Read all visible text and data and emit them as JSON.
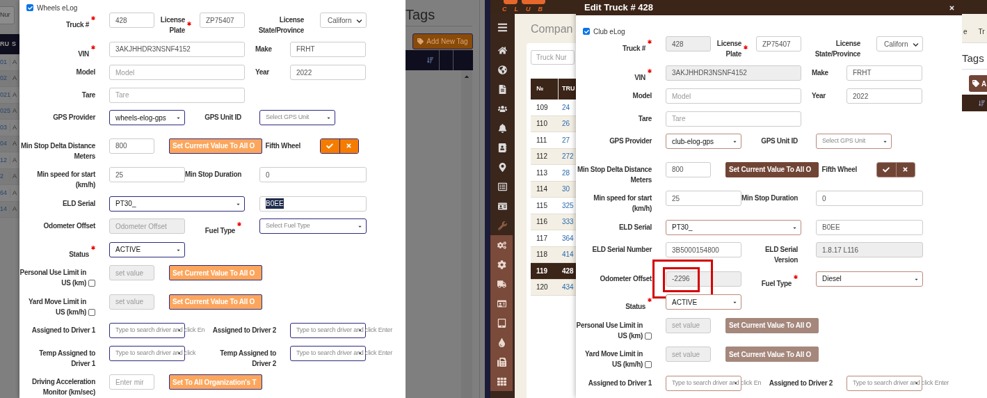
{
  "left_screen": {
    "background_table": {
      "search_placeholder": "Nur",
      "columns": [
        "RU",
        "S"
      ],
      "rows": [
        [
          "01",
          "A"
        ],
        [
          "02",
          "A"
        ],
        [
          "021",
          "A"
        ],
        [
          "025",
          "A"
        ],
        [
          "03",
          "A"
        ],
        [
          "04",
          "A"
        ],
        [
          "12",
          "A"
        ],
        [
          "2",
          "A"
        ],
        [
          "64",
          "A"
        ],
        [
          "14",
          "A"
        ]
      ]
    },
    "tags_panel": {
      "title": "Tags",
      "button": "Add New Tag"
    },
    "form": {
      "checkbox": {
        "label": "Wheels eLog",
        "checked": true
      },
      "groups": [
        {
          "kind": "triple",
          "cells": [
            {
              "kind": "label",
              "text": "Truck #",
              "required": true
            },
            {
              "kind": "input",
              "value": "428",
              "disabled": false
            },
            {
              "kind": "label",
              "text": "License Plate",
              "required": true
            },
            {
              "kind": "input",
              "value": "ZP75407",
              "disabled": false
            },
            {
              "kind": "label",
              "text": "License State/Province",
              "required": false
            },
            {
              "kind": "native-select",
              "value": "Californ"
            }
          ]
        },
        {
          "kind": "wide-pair",
          "cells": [
            {
              "kind": "label",
              "text": "VIN",
              "required": true
            },
            {
              "kind": "input",
              "value": "3AKJHHDR3NSNF4152",
              "disabled": false
            },
            {
              "kind": "label",
              "text": "Make",
              "required": false
            },
            {
              "kind": "input",
              "value": "FRHT",
              "disabled": false
            }
          ]
        },
        {
          "kind": "wide-pair",
          "cells": [
            {
              "kind": "label",
              "text": "Model",
              "required": false
            },
            {
              "kind": "input",
              "placeholder": "Model",
              "disabled": false
            },
            {
              "kind": "label",
              "text": "Year",
              "required": false
            },
            {
              "kind": "input",
              "value": "2022",
              "disabled": false
            }
          ]
        },
        {
          "kind": "wide-single",
          "cells": [
            {
              "kind": "label",
              "text": "Tare",
              "required": false
            },
            {
              "kind": "input",
              "placeholder": "Tare",
              "disabled": false
            }
          ]
        },
        {
          "kind": "mid-pair-short",
          "cells": [
            {
              "kind": "label",
              "text": "GPS Provider",
              "required": false
            },
            {
              "kind": "select",
              "value": "wheels-elog-gps"
            },
            {
              "kind": "label",
              "text": "GPS Unit ID",
              "required": false
            },
            {
              "kind": "select",
              "placeholder": "Select GPS Unit"
            }
          ]
        },
        {
          "kind": "action-toggle",
          "cells": [
            {
              "kind": "label",
              "text": "Min Stop Delta Distance Meters",
              "required": false
            },
            {
              "kind": "input",
              "value": "800",
              "disabled": false
            },
            {
              "kind": "button",
              "text": "Set Current Value To All O",
              "disabled": true
            },
            {
              "kind": "label",
              "text": "Fifth Wheel",
              "required": false
            },
            {
              "kind": "toggle"
            }
          ]
        },
        {
          "kind": "mid-pair",
          "cells": [
            {
              "kind": "label",
              "text": "Min speed for start (km/h)",
              "required": false
            },
            {
              "kind": "input",
              "value": "25",
              "disabled": false
            },
            {
              "kind": "label",
              "text": "Min Stop Duration",
              "required": false
            },
            {
              "kind": "input",
              "value": "0",
              "disabled": false
            }
          ]
        },
        {
          "kind": "wide-plain",
          "cells": [
            {
              "kind": "label",
              "text": "ELD Serial",
              "required": false
            },
            {
              "kind": "select",
              "value": "PT30_"
            },
            {
              "kind": "input",
              "value": "B0EE",
              "disabled": false,
              "text_selected": true
            }
          ]
        },
        {
          "kind": "mid-pair",
          "cells": [
            {
              "kind": "label",
              "text": "Odometer Offset",
              "required": false
            },
            {
              "kind": "input",
              "placeholder": "Odometer Offset",
              "disabled": true
            },
            {
              "kind": "label",
              "text": "Fuel Type",
              "required": true
            },
            {
              "kind": "select",
              "placeholder": "Select Fuel Type"
            }
          ]
        },
        {
          "kind": "mid-single",
          "cells": [
            {
              "kind": "label",
              "text": "Status",
              "required": true
            },
            {
              "kind": "select",
              "value": "ACTIVE"
            }
          ]
        },
        {
          "kind": "action",
          "cells": [
            {
              "kind": "label",
              "text": "Personal Use Limit in US (km)",
              "required": false,
              "checkbox": {
                "checked": false
              }
            },
            {
              "kind": "input",
              "placeholder": "set value",
              "disabled": true
            },
            {
              "kind": "button",
              "text": "Set Current Value To All O",
              "disabled": true
            }
          ]
        },
        {
          "kind": "action",
          "cells": [
            {
              "kind": "label",
              "text": "Yard Move Limit in US (km/h)",
              "required": false,
              "checkbox": {
                "checked": false
              }
            },
            {
              "kind": "input",
              "placeholder": "set value",
              "disabled": true
            },
            {
              "kind": "button",
              "text": "Set Current Value To All O",
              "disabled": true
            }
          ]
        },
        {
          "kind": "driver-pair",
          "cells": [
            {
              "kind": "label",
              "text": "Assigned to Driver 1",
              "required": false
            },
            {
              "kind": "select",
              "placeholder": "Type to search driver and click En"
            },
            {
              "kind": "label",
              "text": "Assigned to Driver 2",
              "required": false
            },
            {
              "kind": "select",
              "placeholder": "Type to search driver and click Enter"
            }
          ]
        },
        {
          "kind": "driver-pair",
          "cells": [
            {
              "kind": "label",
              "text": "Temp Assigned to Driver 1",
              "required": false
            },
            {
              "kind": "select",
              "placeholder": "Type to search driver and click"
            },
            {
              "kind": "label",
              "text": "Temp Assigned to Driver 2",
              "required": false
            },
            {
              "kind": "select",
              "placeholder": "Type to search driver and click Enter"
            }
          ]
        },
        {
          "kind": "action",
          "cells": [
            {
              "kind": "label",
              "text": "Driving Acceleration Monitor (km/sec)",
              "required": false
            },
            {
              "kind": "input",
              "placeholder": "Enter mir",
              "disabled": false
            },
            {
              "kind": "button",
              "text": "Set To All Organization's T",
              "disabled": true
            }
          ]
        }
      ]
    }
  },
  "right_screen": {
    "logo": "CLUB",
    "sidebar": {
      "items": [
        {
          "expanded": false
        },
        {
          "expanded": false
        },
        {
          "expanded": false
        },
        {
          "expanded": false
        },
        {
          "expanded": false
        },
        {
          "expanded": false
        },
        {
          "expanded": false
        },
        {
          "expanded": false
        },
        {
          "expanded": false
        },
        {
          "expanded": true,
          "children": [
            {
              "selected": false
            },
            {
              "selected": false
            },
            {
              "selected": false
            },
            {
              "selected": false
            },
            {
              "selected": false
            },
            {
              "selected": false
            },
            {
              "selected": false
            },
            {
              "selected": false
            }
          ]
        }
      ]
    },
    "page": {
      "title": "Compan",
      "search_placeholder": "Truck Nur",
      "table": {
        "columns": [
          "№",
          "TRU"
        ],
        "rows": [
          {
            "cells": [
              "109",
              "24"
            ],
            "selected": false
          },
          {
            "cells": [
              "110",
              "26"
            ],
            "selected": false
          },
          {
            "cells": [
              "111",
              "27"
            ],
            "selected": false
          },
          {
            "cells": [
              "112",
              "272"
            ],
            "selected": false
          },
          {
            "cells": [
              "113",
              "28"
            ],
            "selected": false
          },
          {
            "cells": [
              "114",
              "30"
            ],
            "selected": false
          },
          {
            "cells": [
              "115",
              "325"
            ],
            "selected": false
          },
          {
            "cells": [
              "116",
              "333"
            ],
            "selected": false
          },
          {
            "cells": [
              "117",
              "364"
            ],
            "selected": false
          },
          {
            "cells": [
              "118",
              "414"
            ],
            "selected": false
          },
          {
            "cells": [
              "119",
              "428"
            ],
            "selected": true
          },
          {
            "cells": [
              "120",
              "434"
            ],
            "selected": false
          }
        ]
      }
    },
    "tabs": [
      {
        "label": "e",
        "selected": false
      },
      {
        "label": "Tr",
        "selected": false
      }
    ],
    "tags_panel": {
      "title": "Tags",
      "button": "A"
    },
    "modal": {
      "title": "Edit Truck # 428",
      "form": {
        "checkbox": {
          "label": "Club eLog",
          "checked": true
        },
        "groups": [
          {
            "kind": "triple",
            "cells": [
              {
                "kind": "label",
                "text": "Truck #",
                "required": true
              },
              {
                "kind": "input",
                "value": "428",
                "disabled": true
              },
              {
                "kind": "label",
                "text": "License Plate",
                "required": true
              },
              {
                "kind": "input",
                "value": "ZP75407",
                "disabled": false
              },
              {
                "kind": "label",
                "text": "License State/Province",
                "required": false
              },
              {
                "kind": "native-select",
                "value": "Californ"
              }
            ]
          },
          {
            "kind": "wide-pair",
            "cells": [
              {
                "kind": "label",
                "text": "VIN",
                "required": true
              },
              {
                "kind": "input",
                "value": "3AKJHHDR3NSNF4152",
                "disabled": true
              },
              {
                "kind": "label",
                "text": "Make",
                "required": false
              },
              {
                "kind": "input",
                "value": "FRHT",
                "disabled": false
              }
            ]
          },
          {
            "kind": "wide-pair",
            "cells": [
              {
                "kind": "label",
                "text": "Model",
                "required": false
              },
              {
                "kind": "input",
                "placeholder": "Model",
                "disabled": false
              },
              {
                "kind": "label",
                "text": "Year",
                "required": false
              },
              {
                "kind": "input",
                "value": "2022",
                "disabled": false
              }
            ]
          },
          {
            "kind": "wide-single",
            "cells": [
              {
                "kind": "label",
                "text": "Tare",
                "required": false
              },
              {
                "kind": "input",
                "placeholder": "Tare",
                "disabled": false
              }
            ]
          },
          {
            "kind": "mid-pair-short",
            "cells": [
              {
                "kind": "label",
                "text": "GPS Provider",
                "required": false
              },
              {
                "kind": "select",
                "value": "club-elog-gps"
              },
              {
                "kind": "label",
                "text": "GPS Unit ID",
                "required": false
              },
              {
                "kind": "select",
                "placeholder": "Select GPS Unit"
              }
            ]
          },
          {
            "kind": "action-toggle",
            "cells": [
              {
                "kind": "label",
                "text": "Min Stop Delta Distance Meters",
                "required": false
              },
              {
                "kind": "input",
                "value": "800",
                "disabled": false
              },
              {
                "kind": "button",
                "text": "Set Current Value To All O",
                "disabled": false
              },
              {
                "kind": "label",
                "text": "Fifth Wheel",
                "required": false
              },
              {
                "kind": "toggle"
              }
            ]
          },
          {
            "kind": "mid-pair",
            "cells": [
              {
                "kind": "label",
                "text": "Min speed for start (km/h)",
                "required": false
              },
              {
                "kind": "input",
                "value": "25",
                "disabled": false
              },
              {
                "kind": "label",
                "text": "Min Stop Duration",
                "required": false
              },
              {
                "kind": "input",
                "value": "0",
                "disabled": false
              }
            ]
          },
          {
            "kind": "wide-plain",
            "cells": [
              {
                "kind": "label",
                "text": "ELD Serial",
                "required": false
              },
              {
                "kind": "select",
                "value": "PT30_"
              },
              {
                "kind": "input",
                "value": "B0EE",
                "disabled": false,
                "text_selected": false
              }
            ]
          },
          {
            "kind": "mid-pair",
            "cells": [
              {
                "kind": "label",
                "text": "ELD Serial Number",
                "required": false
              },
              {
                "kind": "input",
                "value": "3B5000154800",
                "disabled": false
              },
              {
                "kind": "label",
                "text": "ELD Serial Version",
                "required": false
              },
              {
                "kind": "input",
                "value": "1.8.17 L116",
                "disabled": true
              }
            ]
          },
          {
            "kind": "mid-pair",
            "cells": [
              {
                "kind": "label",
                "text": "Odometer Offset",
                "required": false
              },
              {
                "kind": "input",
                "value": "-2296",
                "disabled": true,
                "annotated": true
              },
              {
                "kind": "label",
                "text": "Fuel Type",
                "required": true
              },
              {
                "kind": "select",
                "value": "Diesel"
              }
            ]
          },
          {
            "kind": "mid-single",
            "cells": [
              {
                "kind": "label",
                "text": "Status",
                "required": true
              },
              {
                "kind": "select",
                "value": "ACTIVE"
              }
            ]
          },
          {
            "kind": "action",
            "cells": [
              {
                "kind": "label",
                "text": "Personal Use Limit in US (km)",
                "required": false,
                "checkbox": {
                  "checked": false
                }
              },
              {
                "kind": "input",
                "placeholder": "set value",
                "disabled": true
              },
              {
                "kind": "button",
                "text": "Set Current Value To All O",
                "disabled": true
              }
            ]
          },
          {
            "kind": "action",
            "cells": [
              {
                "kind": "label",
                "text": "Yard Move Limit in US (km/h)",
                "required": false,
                "checkbox": {
                  "checked": false
                }
              },
              {
                "kind": "input",
                "placeholder": "set value",
                "disabled": true
              },
              {
                "kind": "button",
                "text": "Set Current Value To All O",
                "disabled": true
              }
            ]
          },
          {
            "kind": "driver-pair",
            "cells": [
              {
                "kind": "label",
                "text": "Assigned to Driver 1",
                "required": false
              },
              {
                "kind": "select",
                "placeholder": "Type to search driver and click En"
              },
              {
                "kind": "label",
                "text": "Assigned to Driver 2",
                "required": false
              },
              {
                "kind": "select",
                "placeholder": "Type to search driver and click Enter"
              }
            ]
          }
        ]
      }
    }
  }
}
